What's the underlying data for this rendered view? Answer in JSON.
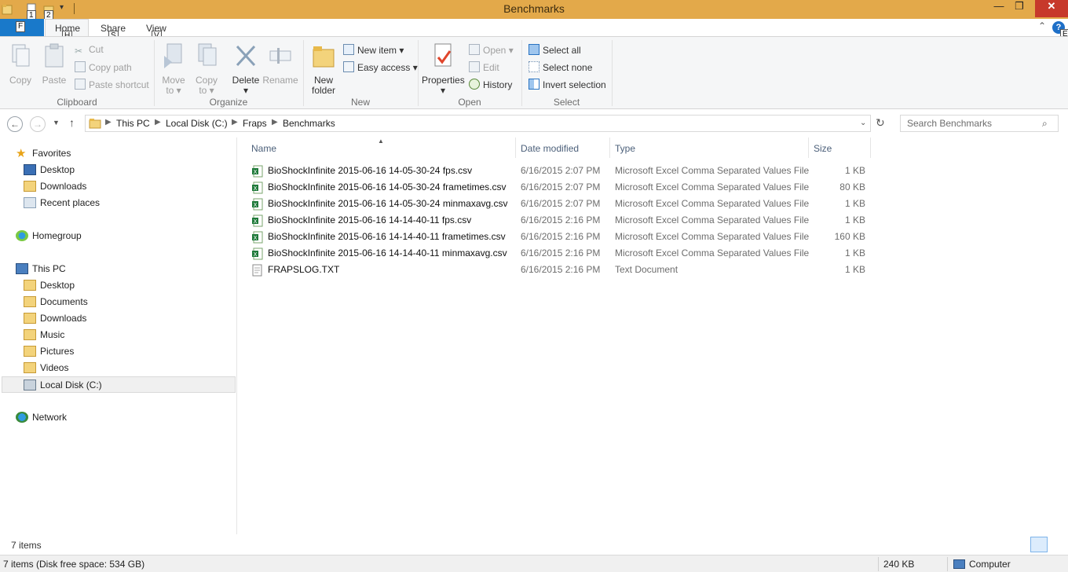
{
  "window": {
    "title": "Benchmarks",
    "minimize_glyph": "—",
    "restore_glyph": "❐",
    "close_glyph": "✕",
    "accent_color": "#e3a94a"
  },
  "keytips": {
    "qat1": "1",
    "qat2": "2",
    "file": "F",
    "home": "H",
    "share": "S",
    "view": "V",
    "help": "E"
  },
  "tabs": {
    "home": "Home",
    "share": "Share",
    "view": "View"
  },
  "ribbon": {
    "clipboard": {
      "label": "Clipboard",
      "copy": "Copy",
      "paste": "Paste",
      "cut": "Cut",
      "copy_path": "Copy path",
      "paste_shortcut": "Paste shortcut"
    },
    "organize": {
      "label": "Organize",
      "move_to_1": "Move",
      "move_to_2": "to ▾",
      "copy_to_1": "Copy",
      "copy_to_2": "to ▾",
      "delete": "Delete",
      "delete_arrow": "▾",
      "rename": "Rename"
    },
    "new": {
      "label": "New",
      "new_folder_1": "New",
      "new_folder_2": "folder",
      "new_item": "New item ▾",
      "easy_access": "Easy access ▾"
    },
    "open": {
      "label": "Open",
      "properties": "Properties",
      "properties_arrow": "▾",
      "open": "Open ▾",
      "edit": "Edit",
      "history": "History"
    },
    "select": {
      "label": "Select",
      "select_all": "Select all",
      "select_none": "Select none",
      "invert_selection": "Invert selection"
    }
  },
  "address": {
    "crumbs": [
      "This PC",
      "Local Disk (C:)",
      "Fraps",
      "Benchmarks"
    ],
    "search_placeholder": "Search Benchmarks"
  },
  "navpane": {
    "favorites": "Favorites",
    "fav_desktop": "Desktop",
    "fav_downloads": "Downloads",
    "fav_recent": "Recent places",
    "homegroup": "Homegroup",
    "thispc": "This PC",
    "pc_desktop": "Desktop",
    "pc_documents": "Documents",
    "pc_downloads": "Downloads",
    "pc_music": "Music",
    "pc_pictures": "Pictures",
    "pc_videos": "Videos",
    "pc_localdisk": "Local Disk (C:)",
    "network": "Network"
  },
  "columns": {
    "name": "Name",
    "date": "Date modified",
    "type": "Type",
    "size": "Size"
  },
  "files": [
    {
      "name": "BioShockInfinite 2015-06-16 14-05-30-24 fps.csv",
      "date": "6/16/2015 2:07 PM",
      "type": "Microsoft Excel Comma Separated Values File",
      "size": "1 KB",
      "icon": "excel-csv-icon"
    },
    {
      "name": "BioShockInfinite 2015-06-16 14-05-30-24 frametimes.csv",
      "date": "6/16/2015 2:07 PM",
      "type": "Microsoft Excel Comma Separated Values File",
      "size": "80 KB",
      "icon": "excel-csv-icon"
    },
    {
      "name": "BioShockInfinite 2015-06-16 14-05-30-24 minmaxavg.csv",
      "date": "6/16/2015 2:07 PM",
      "type": "Microsoft Excel Comma Separated Values File",
      "size": "1 KB",
      "icon": "excel-csv-icon"
    },
    {
      "name": "BioShockInfinite 2015-06-16 14-14-40-11 fps.csv",
      "date": "6/16/2015 2:16 PM",
      "type": "Microsoft Excel Comma Separated Values File",
      "size": "1 KB",
      "icon": "excel-csv-icon"
    },
    {
      "name": "BioShockInfinite 2015-06-16 14-14-40-11 frametimes.csv",
      "date": "6/16/2015 2:16 PM",
      "type": "Microsoft Excel Comma Separated Values File",
      "size": "160 KB",
      "icon": "excel-csv-icon"
    },
    {
      "name": "BioShockInfinite 2015-06-16 14-14-40-11 minmaxavg.csv",
      "date": "6/16/2015 2:16 PM",
      "type": "Microsoft Excel Comma Separated Values File",
      "size": "1 KB",
      "icon": "excel-csv-icon"
    },
    {
      "name": "FRAPSLOG.TXT",
      "date": "6/16/2015 2:16 PM",
      "type": "Text Document",
      "size": "1 KB",
      "icon": "text-document-icon"
    }
  ],
  "status": {
    "item_count": "7 items",
    "disk_info": "7 items (Disk free space: 534 GB)",
    "total_size": "240 KB",
    "location": "Computer"
  }
}
